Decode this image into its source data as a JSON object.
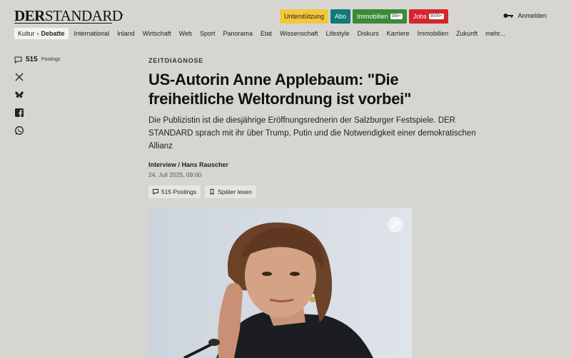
{
  "logo": {
    "part1": "DER",
    "part2": "STANDARD"
  },
  "header": {
    "pills": [
      {
        "label": "Unterstützung",
        "style": "yellow"
      },
      {
        "label": "Abo",
        "style": "teal"
      },
      {
        "label": "Immobilien",
        "tag": "30k+",
        "style": "green"
      },
      {
        "label": "Jobs",
        "tag": "8000+",
        "style": "red"
      }
    ],
    "login_label": "Anmelden"
  },
  "nav": {
    "crumb_parent": "Kultur",
    "crumb_active": "Debatte",
    "items": [
      "International",
      "Inland",
      "Wirtschaft",
      "Web",
      "Sport",
      "Panorama",
      "Etat",
      "Wissenschaft",
      "Lifestyle",
      "Diskurs",
      "Karriere",
      "Immobilien",
      "Zukunft",
      "mehr..."
    ]
  },
  "rail": {
    "postings_count": "515",
    "postings_label": "Postings",
    "share_icons": [
      "x-icon",
      "bluesky-icon",
      "facebook-icon",
      "whatsapp-icon"
    ]
  },
  "article": {
    "kicker": "ZEITDIAGNOSE",
    "title": "US-Autorin Anne Applebaum: \"Die freiheitliche Weltordnung ist vorbei\"",
    "lead": "Die Publizistin ist die diesjährige Eröffnungsrednerin der Salzburger Festspiele. DER STANDARD sprach mit ihr über Trump, Putin und die Notwendigkeit einer demokratischen Allianz",
    "byline": "Interview / Hans Rauscher",
    "date": "24. Juli 2025, 09:00",
    "postings_button": "515 Postings",
    "read_later_button": "Später lesen"
  },
  "colors": {
    "background": "#d6d5d1",
    "support_yellow": "#f2c73b",
    "abo_teal": "#0f7a7a",
    "immo_green": "#3b8a3a",
    "jobs_red": "#d4262c"
  }
}
